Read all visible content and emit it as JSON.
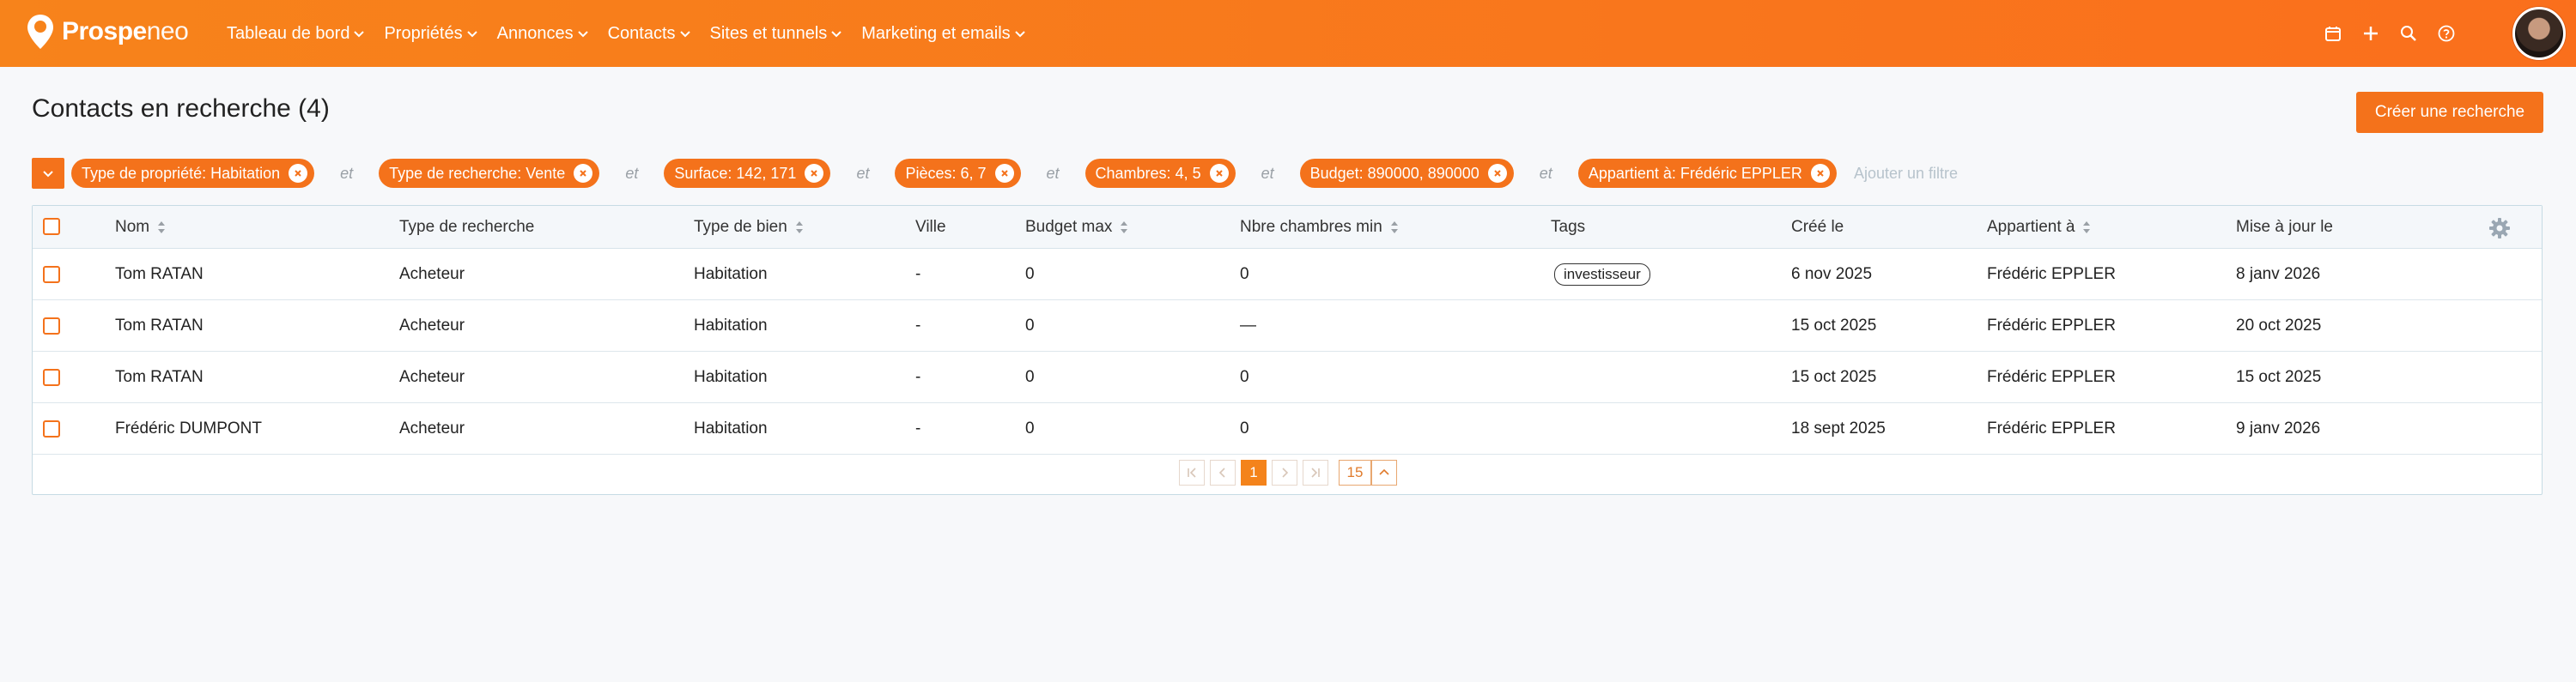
{
  "brand": {
    "name_bold": "Prospe",
    "name_light": "neo"
  },
  "nav": [
    {
      "label": "Tableau de bord"
    },
    {
      "label": "Propriétés"
    },
    {
      "label": "Annonces"
    },
    {
      "label": "Contacts"
    },
    {
      "label": "Sites et tunnels"
    },
    {
      "label": "Marketing et emails"
    }
  ],
  "top_icons": [
    "calendar-icon",
    "plus-icon",
    "search-icon",
    "help-icon"
  ],
  "page": {
    "title": "Contacts en recherche (4)",
    "create_button": "Créer une recherche"
  },
  "filters": {
    "chips": [
      "Type de propriété: Habitation",
      "Type de recherche: Vente",
      "Surface: 142, 171",
      "Pièces: 6, 7",
      "Chambres: 4, 5",
      "Budget: 890000, 890000",
      "Appartient à: Frédéric EPPLER"
    ],
    "and_label": "et",
    "add_placeholder": "Ajouter un filtre"
  },
  "table": {
    "columns": [
      {
        "label": "Nom",
        "sortable": true
      },
      {
        "label": "Type de recherche",
        "sortable": false
      },
      {
        "label": "Type de bien",
        "sortable": true
      },
      {
        "label": "Ville",
        "sortable": false
      },
      {
        "label": "Budget max",
        "sortable": true
      },
      {
        "label": "Nbre chambres min",
        "sortable": true
      },
      {
        "label": "Tags",
        "sortable": false
      },
      {
        "label": "Créé le",
        "sortable": false
      },
      {
        "label": "Appartient à",
        "sortable": true
      },
      {
        "label": "Mise à jour le",
        "sortable": false
      }
    ],
    "rows": [
      {
        "nom": "Tom RATAN",
        "type_recherche": "Acheteur",
        "type_bien": "Habitation",
        "ville": "-",
        "budget": "0",
        "chambres": "0",
        "tag": "investisseur",
        "cree": "6 nov 2025",
        "appartient": "Frédéric EPPLER",
        "maj": "8 janv 2026"
      },
      {
        "nom": "Tom RATAN",
        "type_recherche": "Acheteur",
        "type_bien": "Habitation",
        "ville": "-",
        "budget": "0",
        "chambres": "—",
        "tag": "",
        "cree": "15 oct 2025",
        "appartient": "Frédéric EPPLER",
        "maj": "20 oct 2025"
      },
      {
        "nom": "Tom RATAN",
        "type_recherche": "Acheteur",
        "type_bien": "Habitation",
        "ville": "-",
        "budget": "0",
        "chambres": "0",
        "tag": "",
        "cree": "15 oct 2025",
        "appartient": "Frédéric EPPLER",
        "maj": "15 oct 2025"
      },
      {
        "nom": "Frédéric DUMPONT",
        "type_recherche": "Acheteur",
        "type_bien": "Habitation",
        "ville": "-",
        "budget": "0",
        "chambres": "0",
        "tag": "",
        "cree": "18 sept 2025",
        "appartient": "Frédéric EPPLER",
        "maj": "9 janv 2026"
      }
    ]
  },
  "pagination": {
    "current_page": "1",
    "page_size": "15"
  },
  "colors": {
    "accent": "#f4721b",
    "topbar_start": "#f7831b",
    "topbar_end": "#fa6f1c"
  }
}
